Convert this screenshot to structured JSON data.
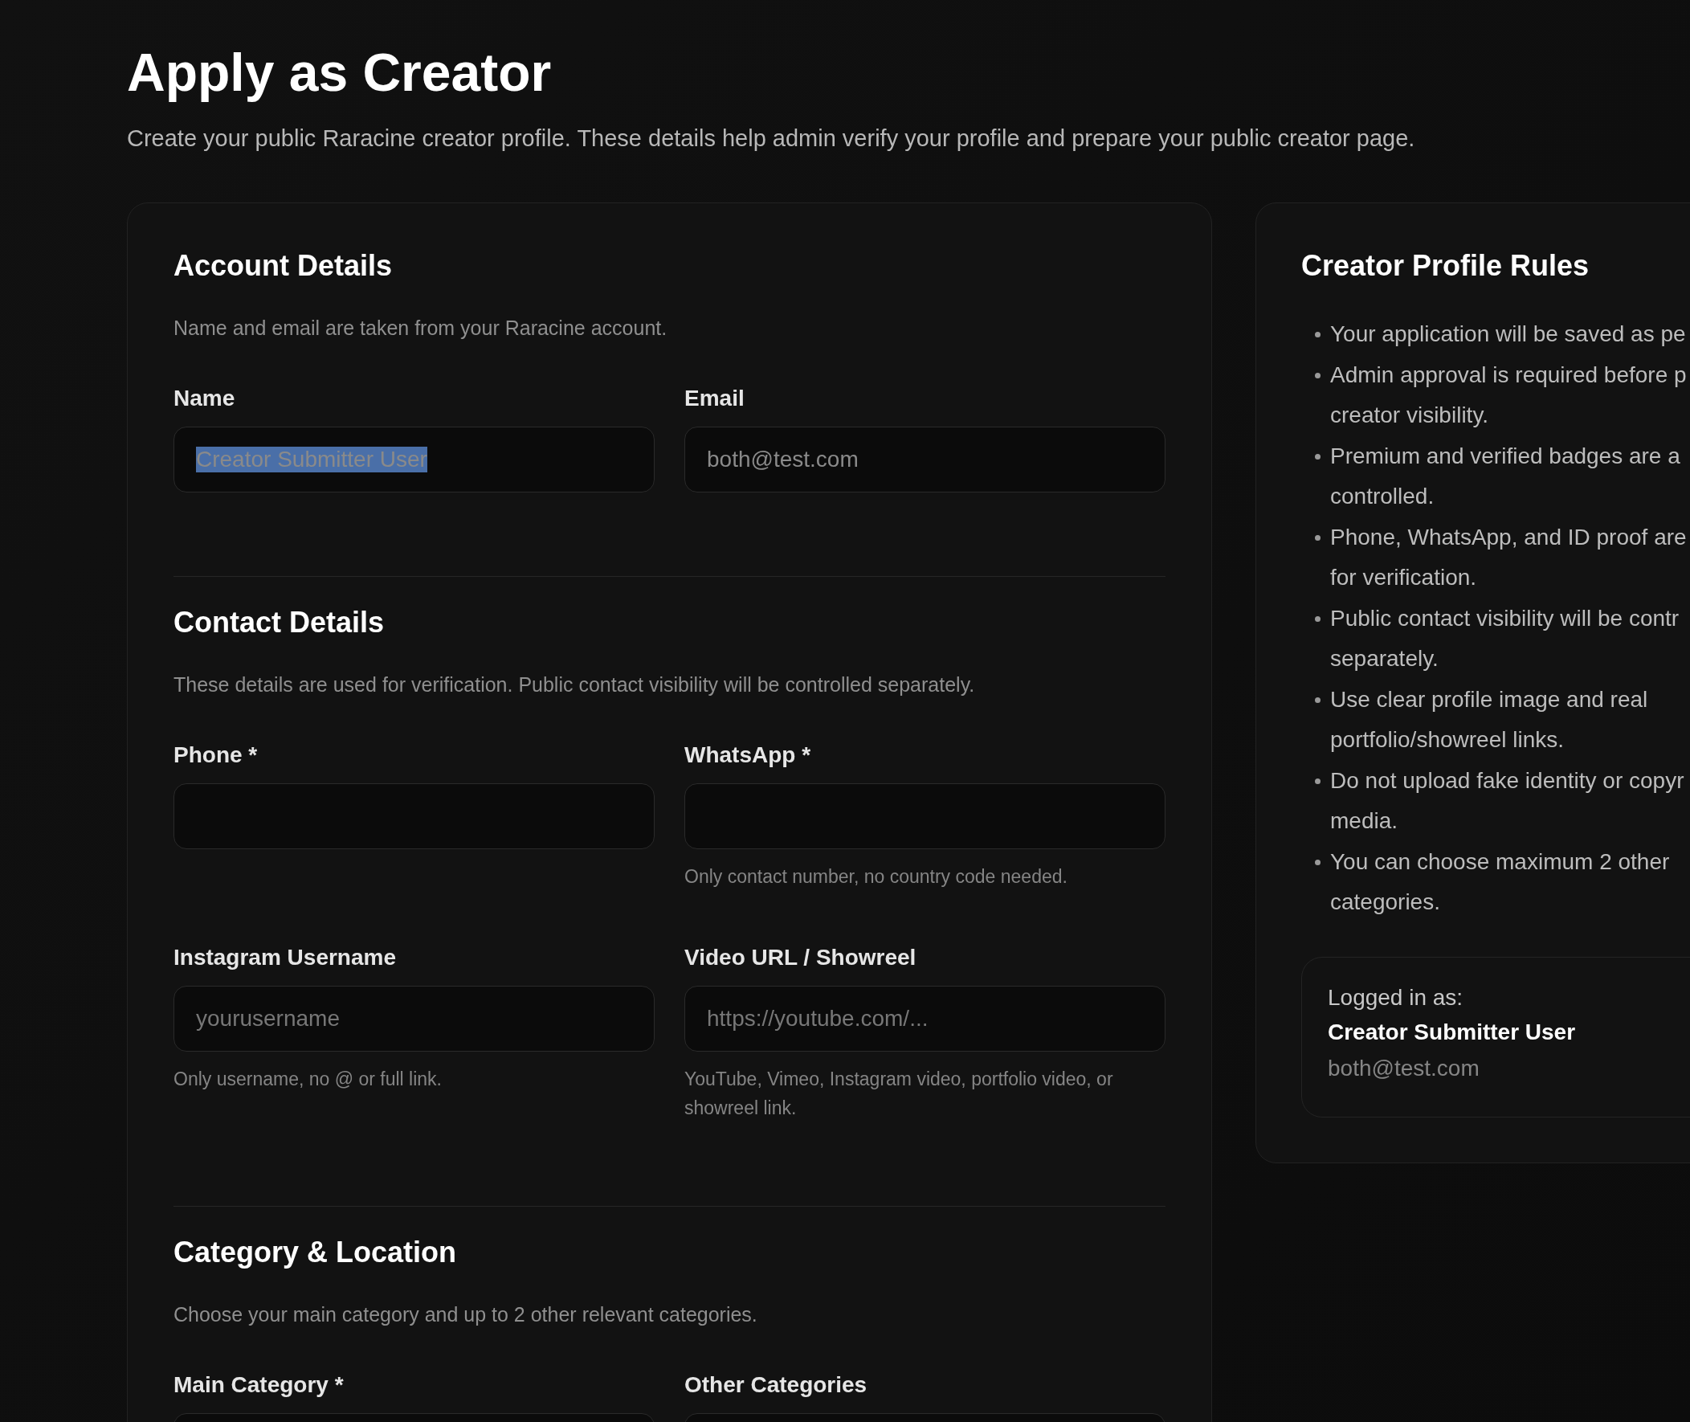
{
  "page": {
    "title": "Apply as Creator",
    "subtitle": "Create your public Raracine creator profile. These details help admin verify your profile and prepare your public creator page."
  },
  "sections": [
    {
      "title": "Account Details",
      "description": "Name and email are taken from your Raracine account.",
      "fields": [
        {
          "label": "Name",
          "value": "Creator Submitter User",
          "selected": true
        },
        {
          "label": "Email",
          "value": "both@test.com",
          "selected": false
        }
      ]
    },
    {
      "title": "Contact Details",
      "description": "These details are used for verification. Public contact visibility will be controlled separately.",
      "fields": [
        {
          "label": "Phone *"
        },
        {
          "label": "WhatsApp *",
          "hint": "Only contact number, no country code needed."
        },
        {
          "label": "Instagram Username",
          "placeholder": "yourusername",
          "hint": "Only username, no @ or full link."
        },
        {
          "label": "Video URL / Showreel",
          "placeholder": "https://youtube.com/...",
          "hint": "YouTube, Vimeo, Instagram video, portfolio video, or showreel link."
        }
      ]
    },
    {
      "title": "Category & Location",
      "description": "Choose your main category and up to 2 other relevant categories.",
      "fields": [
        {
          "label": "Main Category *"
        },
        {
          "label": "Other Categories"
        }
      ]
    }
  ],
  "rules": {
    "title": "Creator Profile Rules",
    "items": [
      {
        "lines": [
          "Your application will be saved as pe"
        ]
      },
      {
        "lines": [
          "Admin approval is required before p",
          "creator visibility."
        ]
      },
      {
        "lines": [
          "Premium and verified badges are a",
          "controlled."
        ]
      },
      {
        "lines": [
          "Phone, WhatsApp, and ID proof are",
          "for verification."
        ]
      },
      {
        "lines": [
          "Public contact visibility will be contr",
          "separately."
        ]
      },
      {
        "lines": [
          "Use clear profile image and real",
          "portfolio/showreel links."
        ]
      },
      {
        "lines": [
          "Do not upload fake identity or copyr",
          "media."
        ]
      },
      {
        "lines": [
          "You can choose maximum 2 other",
          "categories."
        ]
      }
    ],
    "account": {
      "caption": "Logged in as:",
      "name": "Creator Submitter User",
      "email": "both@test.com"
    }
  }
}
